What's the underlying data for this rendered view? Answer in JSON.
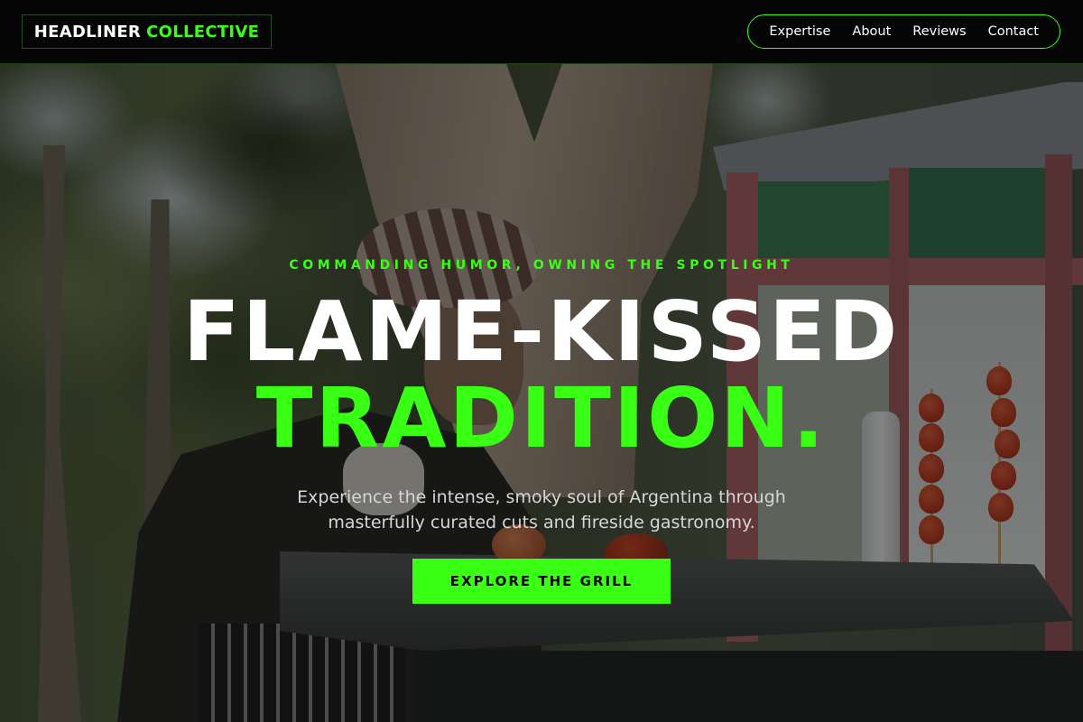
{
  "brand": {
    "name_primary": "HEADLINER",
    "name_accent": "COLLECTIVE"
  },
  "nav": {
    "items": [
      {
        "label": "Expertise"
      },
      {
        "label": "About"
      },
      {
        "label": "Reviews"
      },
      {
        "label": "Contact"
      }
    ]
  },
  "hero": {
    "eyebrow": "COMMANDING HUMOR, OWNING THE SPOTLIGHT",
    "title_line1": "FLAME-KISSED",
    "title_line2": "TRADITION.",
    "description": "Experience the intense, smoky soul of Argentina through masterfully curated cuts and fireside gastronomy.",
    "cta_label": "EXPLORE THE GRILL"
  },
  "colors": {
    "accent": "#39ff14",
    "header_background": "#050505",
    "body_text": "#d6d6d6",
    "cta_text": "#050505"
  }
}
